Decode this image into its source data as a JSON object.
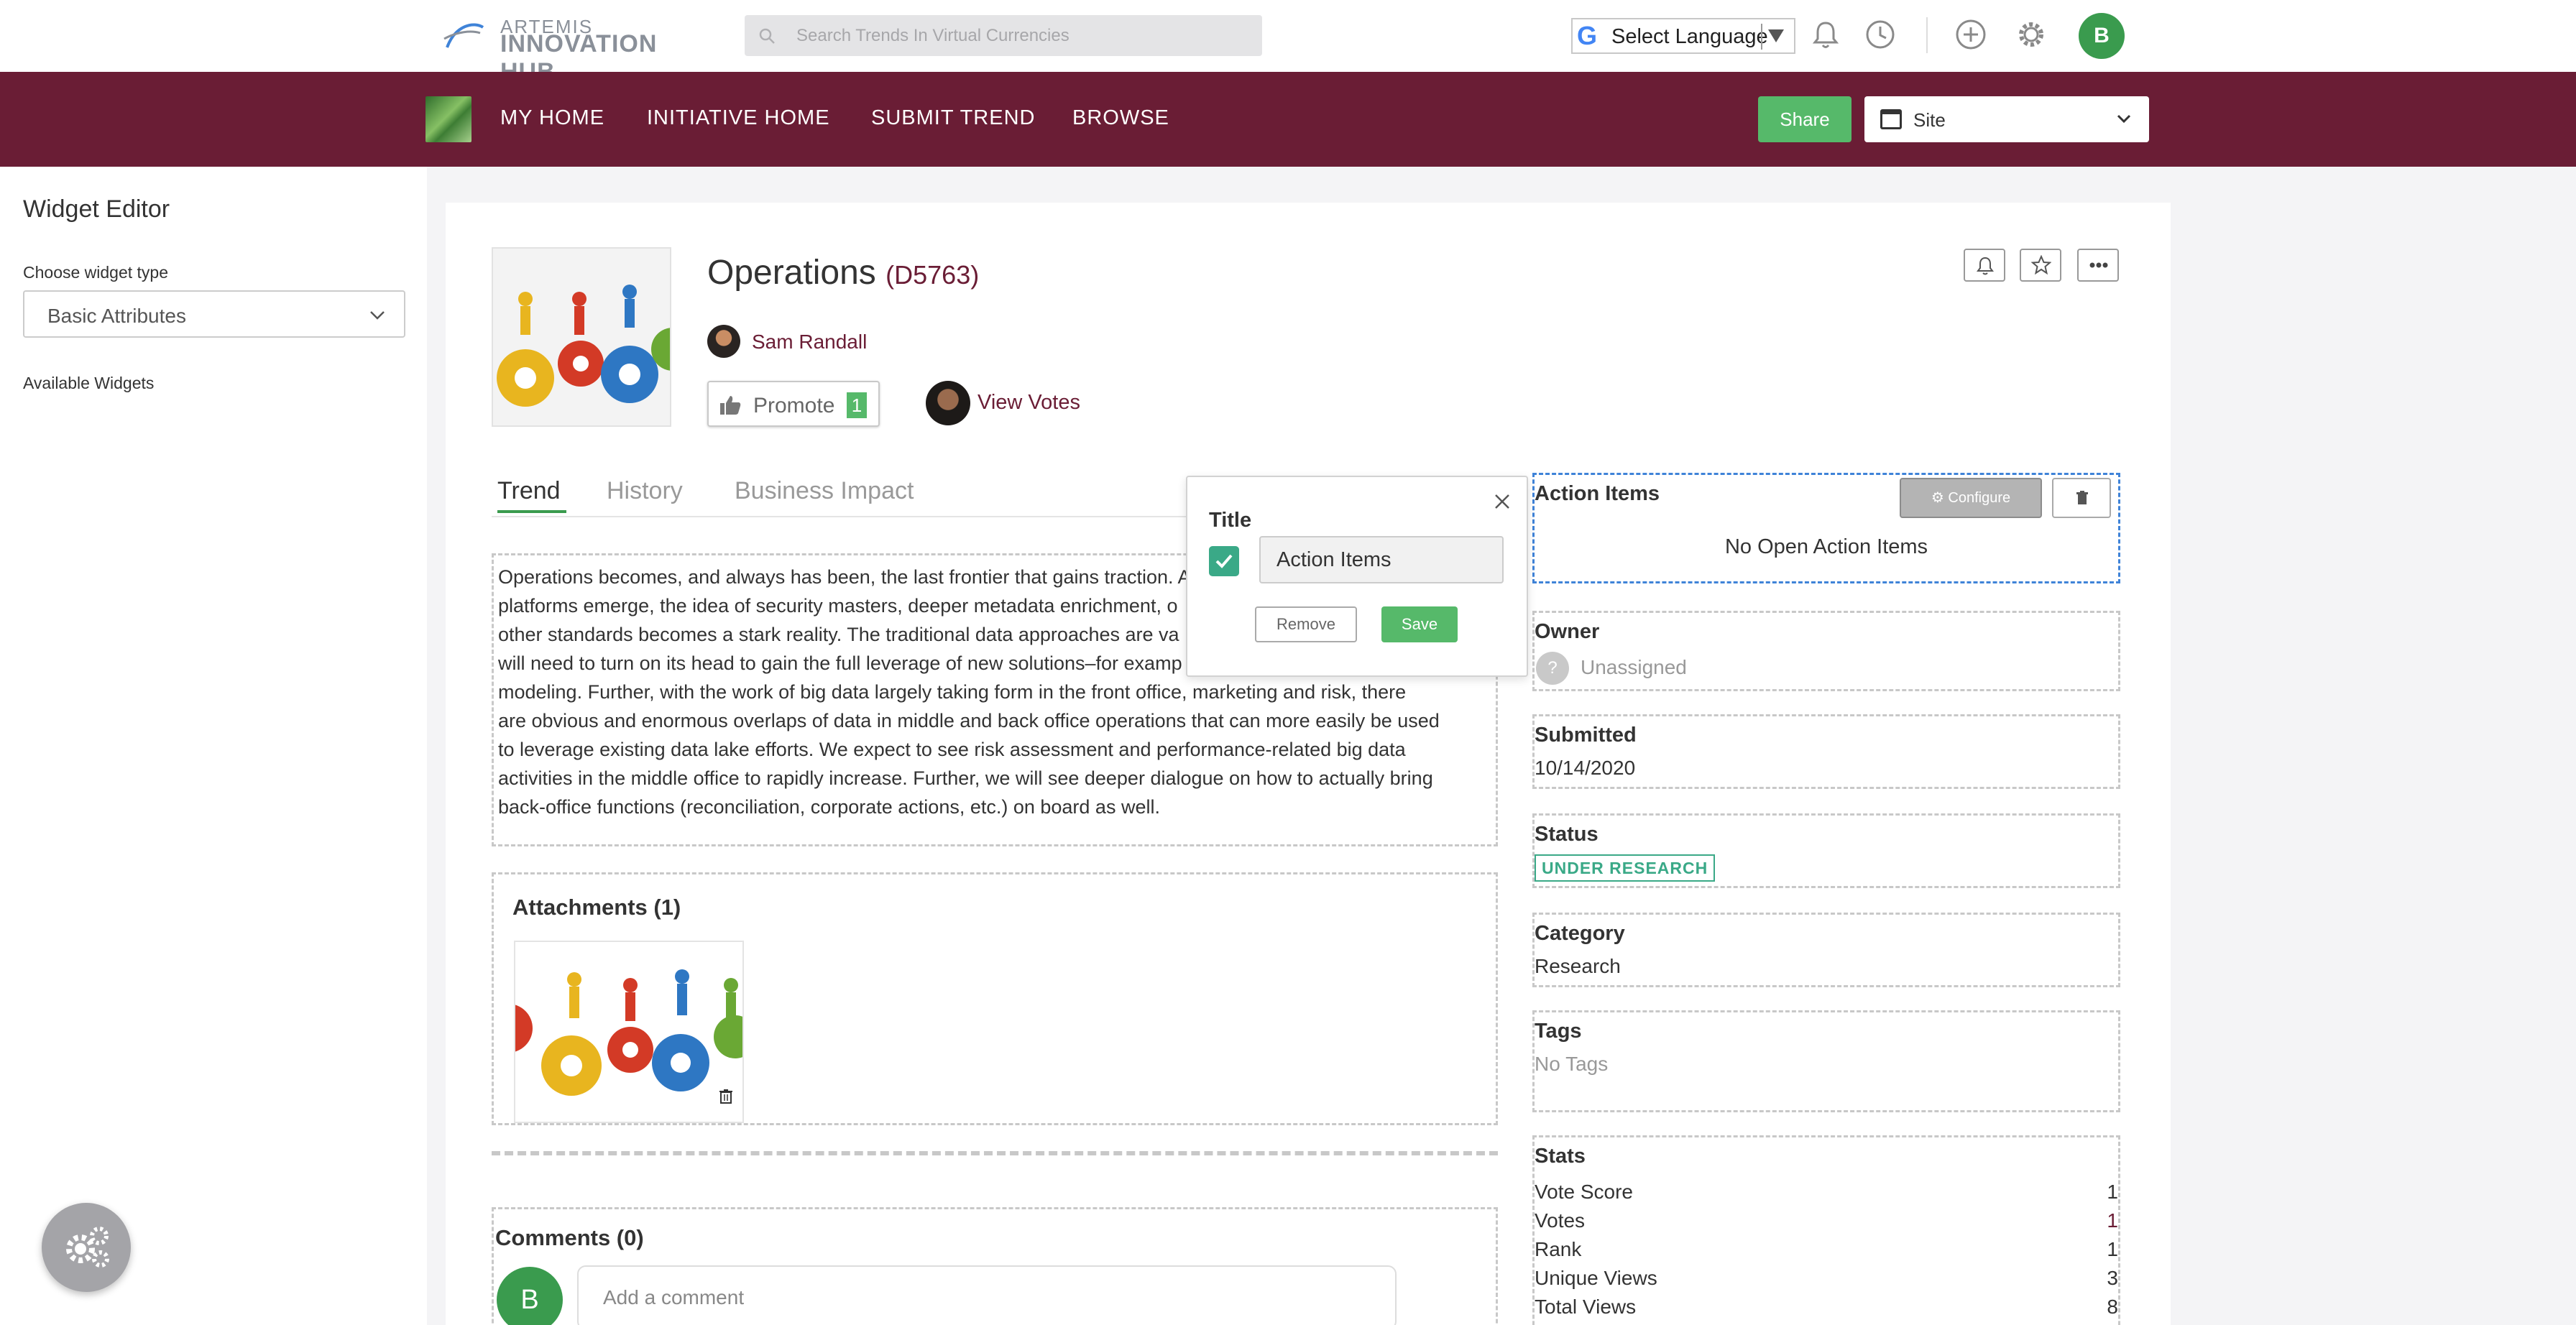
{
  "header": {
    "logo_line1": "ARTEMIS",
    "logo_line2": "INNOVATION HUB",
    "search_placeholder": "Search Trends In Virtual Currencies",
    "language_label": "Select Language",
    "user_initial": "B",
    "icons": [
      "bell-icon",
      "history-icon",
      "plus-icon",
      "gear-icon"
    ]
  },
  "nav": {
    "items": [
      "MY HOME",
      "INITIATIVE HOME",
      "SUBMIT TREND",
      "BROWSE"
    ],
    "share_label": "Share",
    "site_label": "Site"
  },
  "widget_editor": {
    "title": "Widget Editor",
    "choose_label": "Choose widget type",
    "selected_type": "Basic Attributes",
    "available_label": "Available Widgets"
  },
  "trend": {
    "title": "Operations",
    "id": "(D5763)",
    "author": "Sam Randall",
    "promote_label": "Promote",
    "promote_count": "1",
    "view_votes": "View Votes",
    "tabs": [
      "Trend",
      "History",
      "Business Impact"
    ],
    "description_lines": [
      "Operations becomes, and always has been, the last frontier that gains traction. A",
      "platforms emerge, the idea of security masters, deeper metadata enrichment, o",
      "other standards becomes a stark reality. The traditional data approaches are va",
      "will need to turn on its head to gain the full leverage of new solutions–for examp",
      "modeling. Further, with the work of big data largely taking form in the front office, marketing and risk, there",
      "are obvious and enormous overlaps of data in middle and back office operations that can more easily be used",
      "to leverage existing data lake efforts. We expect to see risk assessment and performance-related big data",
      "activities in the middle office to rapidly increase. Further, we will see deeper dialogue on how to actually bring",
      "back-office functions (reconciliation, corporate actions, etc.) on board as well."
    ],
    "attachments_title": "Attachments (1)",
    "comments_title": "Comments (0)",
    "comment_initial": "B",
    "comment_placeholder": "Add a comment"
  },
  "widgets": {
    "action_items": {
      "label": "Action Items",
      "empty_text": "No Open Action Items",
      "configure_label": "Configure"
    },
    "owner": {
      "label": "Owner",
      "value": "Unassigned",
      "icon_text": "?"
    },
    "submitted": {
      "label": "Submitted",
      "value": "10/14/2020"
    },
    "status": {
      "label": "Status",
      "value": "UNDER RESEARCH"
    },
    "category": {
      "label": "Category",
      "value": "Research"
    },
    "tags": {
      "label": "Tags",
      "value": "No Tags"
    },
    "stats": {
      "label": "Stats",
      "rows": [
        {
          "label": "Vote Score",
          "value": "1"
        },
        {
          "label": "Votes",
          "value": "1"
        },
        {
          "label": "Rank",
          "value": "1"
        },
        {
          "label": "Unique Views",
          "value": "3"
        },
        {
          "label": "Total Views",
          "value": "8"
        }
      ]
    }
  },
  "popup": {
    "title": "Title",
    "input_value": "Action Items",
    "remove_label": "Remove",
    "save_label": "Save"
  },
  "colors": {
    "brand": "#6a1d35",
    "accent_green": "#56b96a",
    "status_teal": "#3aa987",
    "selected_outline": "#3f83d8"
  }
}
